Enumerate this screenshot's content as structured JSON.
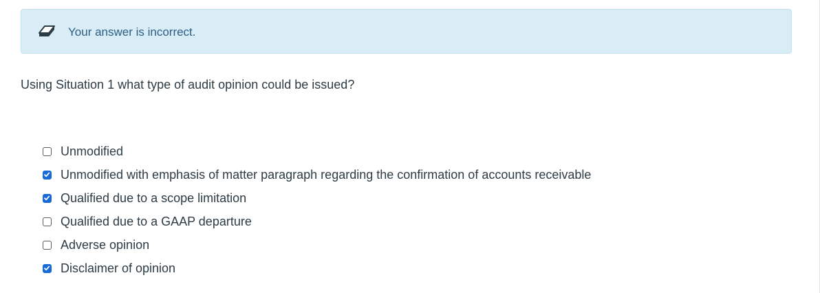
{
  "feedback": {
    "icon": "eraser-icon",
    "message": "Your answer is incorrect.",
    "background_color": "#d9edf7",
    "text_color": "#2d5d84"
  },
  "question": {
    "text": "Using Situation 1 what type of audit opinion could be issued?"
  },
  "answers": [
    {
      "label": "Unmodified",
      "checked": false
    },
    {
      "label": "Unmodified with emphasis of matter paragraph regarding the confirmation of accounts receivable",
      "checked": true
    },
    {
      "label": "Qualified due to a scope limitation",
      "checked": true
    },
    {
      "label": "Qualified due to a GAAP departure",
      "checked": false
    },
    {
      "label": "Adverse opinion",
      "checked": false
    },
    {
      "label": "Disclaimer of opinion",
      "checked": true
    }
  ],
  "colors": {
    "checkbox_checked": "#1a6ad6",
    "text": "#2d3b45"
  }
}
